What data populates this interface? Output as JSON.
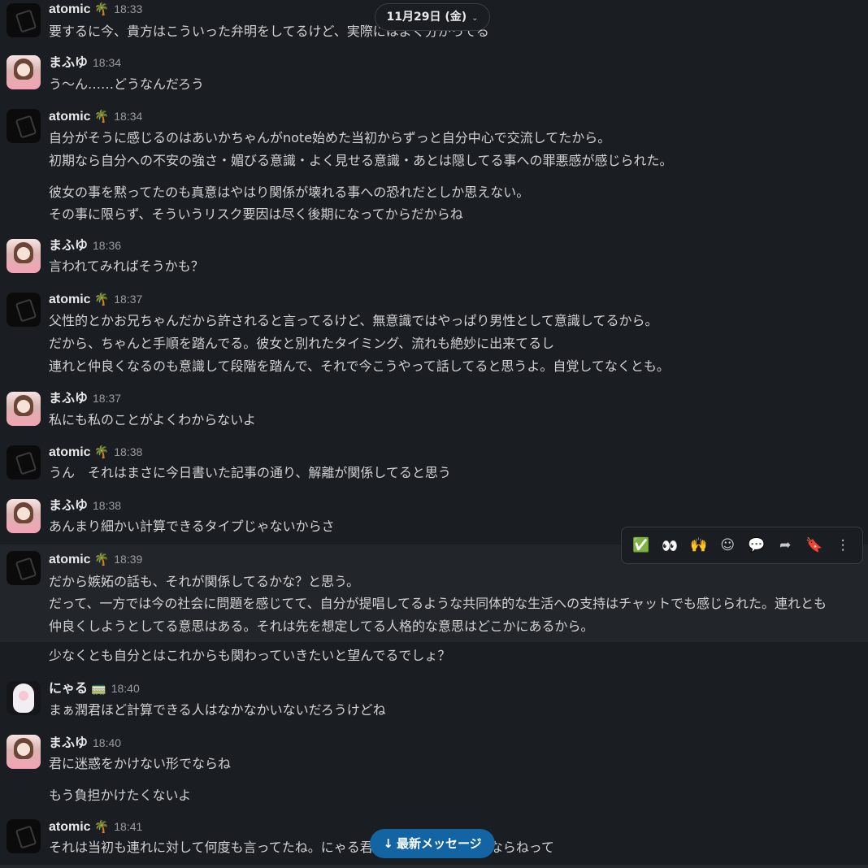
{
  "date_divider": {
    "label": "11月29日 (金)"
  },
  "messages": [
    {
      "author": "atomic",
      "emoji": "🌴",
      "time": "18:33",
      "lines": [
        "要するに今、貴方はこういった弁明をしてるけど、実際にはよく分かってる"
      ]
    },
    {
      "author": "まふゆ",
      "time": "18:34",
      "lines": [
        "う～ん……どうなんだろう"
      ]
    },
    {
      "author": "atomic",
      "emoji": "🌴",
      "time": "18:34",
      "lines": [
        "自分がそうに感じるのはあいかちゃんがnote始めた当初からずっと自分中心で交流してたから。",
        "初期なら自分への不安の強さ・媚びる意識・よく見せる意識・あとは隠してる事への罪悪感が感じられた。",
        "彼女の事を黙ってたのも真意はやはり関係が壊れる事への恐れだとしか思えない。",
        "その事に限らず、そういうリスク要因は尽く後期になってからだからね"
      ]
    },
    {
      "author": "まふゆ",
      "time": "18:36",
      "lines": [
        "言われてみればそうかも？"
      ]
    },
    {
      "author": "atomic",
      "emoji": "🌴",
      "time": "18:37",
      "lines": [
        "父性的とかお兄ちゃんだから許されると言ってるけど、無意識ではやっぱり男性として意識してるから。",
        "だから、ちゃんと手順を踏んでる。彼女と別れたタイミング、流れも絶妙に出来てるし",
        "連れと仲良くなるのも意識して段階を踏んで、それで今こうやって話してると思うよ。自覚してなくとも。"
      ]
    },
    {
      "author": "まふゆ",
      "time": "18:37",
      "lines": [
        "私にも私のことがよくわからないよ"
      ]
    },
    {
      "author": "atomic",
      "emoji": "🌴",
      "time": "18:38",
      "lines": [
        "うん　それはまさに今日書いた記事の通り、解離が関係してると思う"
      ]
    },
    {
      "author": "まふゆ",
      "time": "18:38",
      "lines": [
        "あんまり細かい計算できるタイプじゃないからさ"
      ]
    },
    {
      "author": "atomic",
      "emoji": "🌴",
      "time": "18:39",
      "lines": [
        "だから嫉妬の話も、それが関係してるかな？と思う。",
        "だって、一方では今の社会に問題を感じてて、自分が提唱してるような共同体的な生活への支持はチャットでも感じられた。連れとも",
        "仲良くしようとしてる意思はある。それは先を想定してる人格的な意思はどこかにあるから。",
        "少なくとも自分とはこれからも関わっていきたいと望んでるでしょ？"
      ]
    },
    {
      "author": "にゃる",
      "emoji": "🚃",
      "time": "18:40",
      "lines": [
        "まぁ潤君ほど計算できる人はなかなかいないだろうけどね"
      ]
    },
    {
      "author": "まふゆ",
      "time": "18:40",
      "lines": [
        "君に迷惑をかけない形でならね",
        "もう負担かけたくないよ"
      ]
    },
    {
      "author": "atomic",
      "emoji": "🌴",
      "time": "18:41",
      "lines": [
        "それは当初も連れに対して何度も言ってたね。にゃる君に迷惑をかけない形ならねって"
      ]
    }
  ],
  "hover_toolbar": {
    "icons": [
      "check-reaction-icon",
      "eyes-reaction-icon",
      "raised-hands-reaction-icon",
      "add-reaction-icon",
      "reply-thread-icon",
      "share-icon",
      "bookmark-icon",
      "more-actions-icon"
    ]
  },
  "new_messages_button": {
    "label": "最新メッセージ"
  },
  "colors": {
    "background": "#1a1d21",
    "hover": "#222529",
    "accent": "#1264a3"
  }
}
